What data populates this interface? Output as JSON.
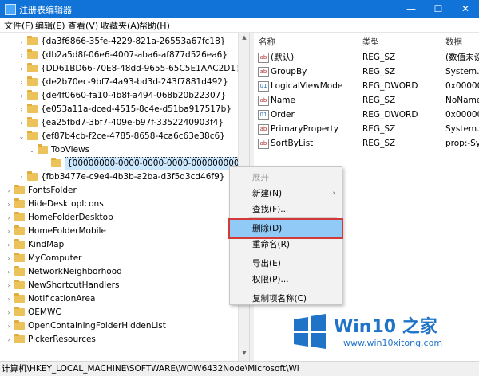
{
  "window": {
    "title": "注册表编辑器",
    "minimize": "—",
    "maximize": "☐",
    "close": "✕"
  },
  "menu": [
    "文件(F)",
    "编辑(E)",
    "查看(V)",
    "收藏夹(A)",
    "帮助(H)"
  ],
  "tree": [
    {
      "label": "{da3f6866-35fe-4229-821a-26553a67fc18}",
      "arrow": "›"
    },
    {
      "label": "{db2a5d8f-06e6-4007-aba6-af877d526ea6}",
      "arrow": "›"
    },
    {
      "label": "{DD61BD66-70E8-48dd-9655-65C5E1AAC2D1}",
      "arrow": "›"
    },
    {
      "label": "{de2b70ec-9bf7-4a93-bd3d-243f7881d492}",
      "arrow": "›"
    },
    {
      "label": "{de4f0660-fa10-4b8f-a494-068b20b22307}",
      "arrow": "›"
    },
    {
      "label": "{e053a11a-dced-4515-8c4e-d51ba917517b}",
      "arrow": "›"
    },
    {
      "label": "{ea25fbd7-3bf7-409e-b97f-3352240903f4}",
      "arrow": "›"
    },
    {
      "label": "{ef87b4cb-f2ce-4785-8658-4ca6c63e38c6}",
      "arrow": "⌄"
    },
    {
      "label": "TopViews",
      "arrow": "⌄"
    },
    {
      "label": "{00000000-0000-0000-0000-000000000000}",
      "arrow": ""
    },
    {
      "label": "{fbb3477e-c9e4-4b3b-a2ba-d3f5d3cd46f9}",
      "arrow": "›"
    },
    {
      "label": "FontsFolder",
      "arrow": "›"
    },
    {
      "label": "HideDesktopIcons",
      "arrow": "›"
    },
    {
      "label": "HomeFolderDesktop",
      "arrow": "›"
    },
    {
      "label": "HomeFolderMobile",
      "arrow": "›"
    },
    {
      "label": "KindMap",
      "arrow": "›"
    },
    {
      "label": "MyComputer",
      "arrow": "›"
    },
    {
      "label": "NetworkNeighborhood",
      "arrow": "›"
    },
    {
      "label": "NewShortcutHandlers",
      "arrow": "›"
    },
    {
      "label": "NotificationArea",
      "arrow": "›"
    },
    {
      "label": "OEMWC",
      "arrow": "›"
    },
    {
      "label": "OpenContainingFolderHiddenList",
      "arrow": "›"
    },
    {
      "label": "PickerResources",
      "arrow": "›"
    }
  ],
  "columns": {
    "name": "名称",
    "type": "类型",
    "data": "数据"
  },
  "values": [
    {
      "icon": "ab",
      "name": "(默认)",
      "type": "REG_SZ",
      "data": "(数值未设"
    },
    {
      "icon": "ab",
      "name": "GroupBy",
      "type": "REG_SZ",
      "data": "System.S"
    },
    {
      "icon": "01",
      "name": "LogicalViewMode",
      "type": "REG_DWORD",
      "data": "0x000000"
    },
    {
      "icon": "ab",
      "name": "Name",
      "type": "REG_SZ",
      "data": "NoName"
    },
    {
      "icon": "01",
      "name": "Order",
      "type": "REG_DWORD",
      "data": "0x000000"
    },
    {
      "icon": "ab",
      "name": "PrimaryProperty",
      "type": "REG_SZ",
      "data": "System.S"
    },
    {
      "icon": "ab",
      "name": "SortByList",
      "type": "REG_SZ",
      "data": "prop:-Sy"
    }
  ],
  "context_menu": {
    "items": [
      {
        "label": "展开",
        "state": "disabled"
      },
      {
        "label": "新建(N)",
        "submenu": "›"
      },
      {
        "label": "查找(F)..."
      },
      {
        "label": "删除(D)",
        "state": "highlight"
      },
      {
        "label": "重命名(R)"
      },
      {
        "label": "导出(E)"
      },
      {
        "label": "权限(P)..."
      },
      {
        "label": "复制项名称(C)"
      }
    ]
  },
  "status": {
    "path": "计算机\\HKEY_LOCAL_MACHINE\\SOFTWARE\\WOW6432Node\\Microsoft\\Wi"
  },
  "watermark": {
    "title": "Win10 之家",
    "url": "www.win10xitong.com"
  },
  "colors": {
    "accent": "#1173d8",
    "highlight": "#91c9f7",
    "highlight_outline": "#d23a3a",
    "folder": "#ecc25b"
  }
}
